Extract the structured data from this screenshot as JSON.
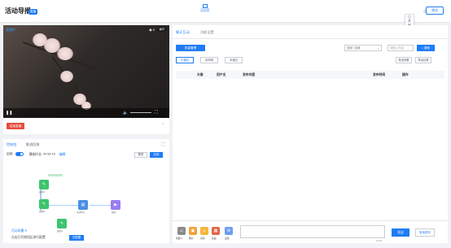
{
  "header": {
    "title": "活动导播",
    "badge": "直播",
    "tabs": [
      {
        "label": "活动页"
      },
      {
        "label": "开启直播"
      }
    ],
    "right_button": "预览"
  },
  "video": {
    "status": "直播中",
    "viewers": "0",
    "viewer_label": "观看",
    "pip_label": "画中",
    "end_live_button": "结束直播"
  },
  "control": {
    "tabs": [
      "控制台",
      "推流回放"
    ],
    "switch_label": "启用",
    "duration_label": "播放时长:",
    "duration_value": "00:54:16",
    "edit_link": "编辑",
    "preview_button": "预览",
    "apply_button": "应用"
  },
  "flow": {
    "nodes": [
      {
        "label": "选择A",
        "type": "green"
      },
      {
        "label": "选择B",
        "type": "green"
      },
      {
        "label": "选择C",
        "type": "green"
      },
      {
        "label": "互动环节",
        "type": "blue"
      },
      {
        "label": "视频",
        "type": "purple"
      }
    ]
  },
  "bottom_left": {
    "link_text": "活动导播",
    "hint_text": "点击打开按钮后进行配置",
    "hint_button": "去配置"
  },
  "right_panel": {
    "tabs": [
      "聊天互动",
      "功能设置"
    ],
    "primary_button": "批量管理",
    "select_value": "全部 / 全部",
    "search_placeholder": "请输入内容",
    "search_button": "搜索",
    "filter_tabs": [
      "已通过",
      "待审核",
      "未通过"
    ],
    "right_buttons": [
      "导出列表",
      "导出记录"
    ],
    "table_headers": [
      "头像",
      "用户名",
      "发布内容",
      "发布时间",
      "操作"
    ]
  },
  "composer": {
    "tools": [
      "机器人",
      "图片",
      "表情",
      "商品",
      "设置"
    ],
    "counter": "0/100",
    "send_button": "发送",
    "quick_button": "常用语句"
  }
}
